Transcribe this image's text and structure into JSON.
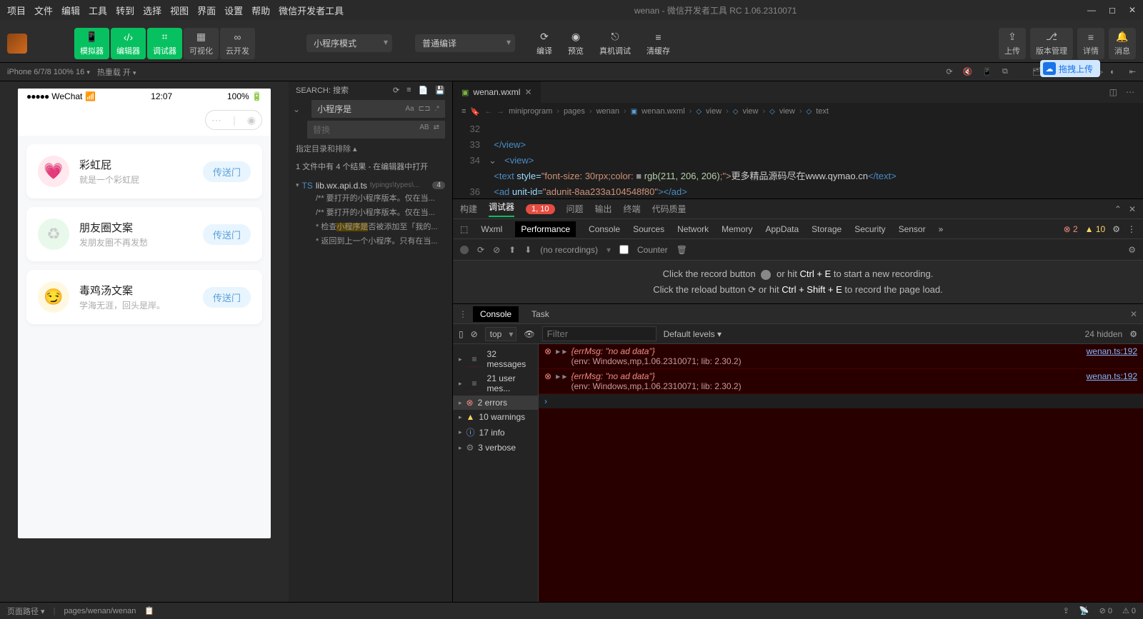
{
  "menubar": {
    "items": [
      "项目",
      "文件",
      "编辑",
      "工具",
      "转到",
      "选择",
      "视图",
      "界面",
      "设置",
      "帮助",
      "微信开发者工具"
    ],
    "title": "wenan - 微信开发者工具 RC 1.06.2310071"
  },
  "toolbar": {
    "groups": {
      "sim": {
        "icon": "📱",
        "label": "模拟器"
      },
      "editor": {
        "icon": "‹/›",
        "label": "编辑器"
      },
      "debugger": {
        "icon": "⌗",
        "label": "调试器"
      },
      "visual": {
        "icon": "▦",
        "label": "可视化"
      },
      "cloud": {
        "icon": "∞",
        "label": "云开发"
      }
    },
    "mode_dropdown": "小程序模式",
    "compile_dropdown": "普通编译",
    "compile": {
      "icon": "⟳",
      "label": "编译"
    },
    "preview": {
      "icon": "◉",
      "label": "预览"
    },
    "remote": {
      "icon": "⎋",
      "label": "真机调试"
    },
    "clearcache": {
      "icon": "≡",
      "label": "清缓存"
    },
    "upload": {
      "icon": "⇪",
      "label": "上传"
    },
    "version": {
      "icon": "⎇",
      "label": "版本管理"
    },
    "details": {
      "icon": "≡",
      "label": "详情"
    },
    "message": {
      "icon": "🔔",
      "label": "消息"
    }
  },
  "devicebar": {
    "device": "iPhone 6/7/8 100% 16",
    "reload": "热重载 开",
    "upload_pill": "拖拽上传"
  },
  "phone": {
    "carrier": "WeChat",
    "time": "12:07",
    "battery": "100%",
    "cards": [
      {
        "title": "彩虹屁",
        "sub": "就是一个彩虹屁",
        "btn": "传送门",
        "color": "pink",
        "emoji": "💗"
      },
      {
        "title": "朋友圈文案",
        "sub": "发朋友圈不再发愁",
        "btn": "传送门",
        "color": "green",
        "emoji": "♻"
      },
      {
        "title": "毒鸡汤文案",
        "sub": "学海无涯，回头是岸。",
        "btn": "传送门",
        "color": "yellow",
        "emoji": "😏"
      }
    ]
  },
  "search": {
    "header": "SEARCH: 搜索",
    "query": "小程序是",
    "replace_placeholder": "替换",
    "exclude_label": "指定目录和排除 ▴",
    "result_summary": "1 文件中有 4 个结果 - 在编辑器中打开",
    "file": {
      "name": "lib.wx.api.d.ts",
      "hint": "typings\\types\\...",
      "count": "4"
    },
    "lines": [
      "/** 要打开的小程序版本。仅在当...",
      "/** 要打开的小程序版本。仅在当...",
      "* 检查小程序是否被添加至「我的...",
      "* 返回到上一个小程序。只有在当..."
    ]
  },
  "editor": {
    "tab_filename": "wenan.wxml",
    "breadcrumb": [
      "miniprogram",
      "pages",
      "wenan",
      "wenan.wxml",
      "view",
      "view",
      "view",
      "text"
    ],
    "lines": {
      "32": "</view>",
      "33": "<view>",
      "34_pre": "<text ",
      "34_style_attr": "style=",
      "34_style_val": "\"font-size: 30rpx;color: ",
      "34_rgb": "rgb(211, 206, 206)",
      "34_close": ";\">",
      "34_text": "更多精品源码尽在www.qymao.cn",
      "34_end": "</text>",
      "35_pre": "<ad ",
      "35_attr": "unit-id=",
      "35_val": "\"adunit-8aa233a104548f80\"",
      "35_end": "></ad>",
      "36": "</view>"
    }
  },
  "devtools": {
    "tabs1": [
      "构建",
      "调试器",
      "问题",
      "输出",
      "终端",
      "代码质量"
    ],
    "tabs1_badge": "1, 10",
    "tabs2": [
      "Wxml",
      "Performance",
      "Console",
      "Sources",
      "Network",
      "Memory",
      "AppData",
      "Storage",
      "Security",
      "Sensor"
    ],
    "err_count": "2",
    "warn_count": "10",
    "perf": {
      "norecord": "(no recordings)",
      "counter": "Counter",
      "hint_record_pre": "Click the record button",
      "hint_record_post": "or hit ",
      "hint_record_key": "Ctrl + E",
      "hint_record_end": " to start a new recording.",
      "hint_reload_pre": "Click the reload button",
      "hint_reload_key": "Ctrl + Shift + E",
      "hint_reload_end": " to record the page load."
    }
  },
  "drawer": {
    "tabs": [
      "Console",
      "Task"
    ],
    "context": "top",
    "filter_placeholder": "Filter",
    "levels": "Default levels ▾",
    "hidden": "24 hidden",
    "sidebar": [
      {
        "icon": "msg",
        "label": "32 messages"
      },
      {
        "icon": "msg",
        "label": "21 user mes..."
      },
      {
        "icon": "err",
        "label": "2 errors",
        "sel": true
      },
      {
        "icon": "warn",
        "label": "10 warnings"
      },
      {
        "icon": "info",
        "label": "17 info"
      },
      {
        "icon": "verb",
        "label": "3 verbose"
      }
    ],
    "messages": [
      {
        "err": "{errMsg: \"no ad data\"}",
        "env": "(env: Windows,mp,1.06.2310071; lib: 2.30.2)",
        "src": "wenan.ts:192"
      },
      {
        "err": "{errMsg: \"no ad data\"}",
        "env": "(env: Windows,mp,1.06.2310071; lib: 2.30.2)",
        "src": "wenan.ts:192"
      }
    ]
  },
  "statusbar": {
    "pagepath_label": "页面路径 ▾",
    "pagepath": "pages/wenan/wenan",
    "errors": "⊘ 0",
    "warnings": "⚠ 0"
  }
}
